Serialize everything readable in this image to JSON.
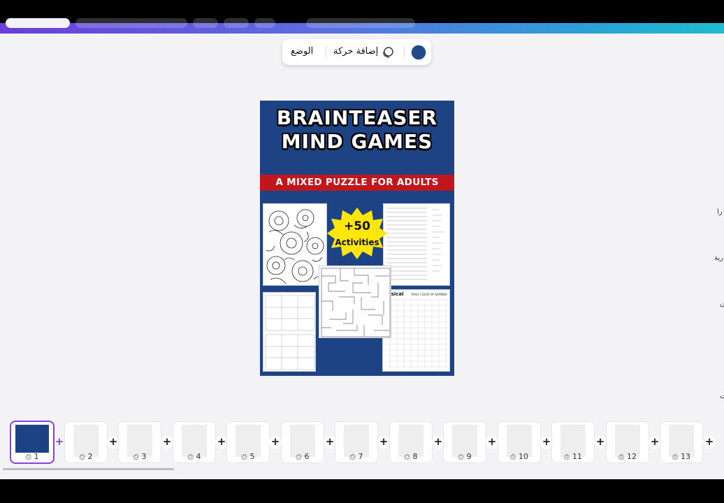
{
  "toolbar": {
    "position_label": "الوضع",
    "add_animation_label": "إضافة حركة",
    "color": "#1e4a8a"
  },
  "cover": {
    "title_line1": "BRAINTEASER",
    "title_line2": "MIND GAMES",
    "subtitle": "A MIXED PUZZLE FOR ADULTS",
    "badge_count": "+50",
    "badge_label": "Activities",
    "whimsical_label": "imsical",
    "color_by_number_label": "PIXEL COLOR BY NUMBER",
    "background_color": "#1d4384",
    "band_color": "#c0161c",
    "badge_color": "#ffe60a"
  },
  "right_panel": {
    "labels": [
      "را",
      "رية",
      "ن",
      "ت"
    ]
  },
  "pages": {
    "items": [
      {
        "num": "1"
      },
      {
        "num": "2"
      },
      {
        "num": "3"
      },
      {
        "num": "4"
      },
      {
        "num": "5"
      },
      {
        "num": "6"
      },
      {
        "num": "7"
      },
      {
        "num": "8"
      },
      {
        "num": "9"
      },
      {
        "num": "10"
      },
      {
        "num": "11"
      },
      {
        "num": "12"
      },
      {
        "num": "13"
      }
    ],
    "add_symbol": "+",
    "print_icon": "print-icon"
  }
}
